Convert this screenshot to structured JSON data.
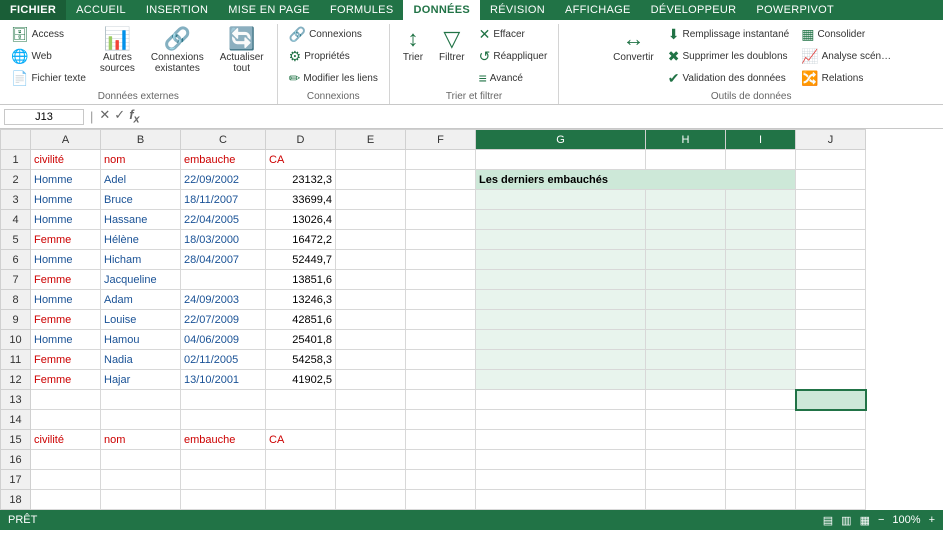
{
  "ribbon": {
    "tabs": [
      {
        "label": "FICHIER",
        "active": false
      },
      {
        "label": "ACCUEIL",
        "active": false
      },
      {
        "label": "INSERTION",
        "active": false
      },
      {
        "label": "MISE EN PAGE",
        "active": false
      },
      {
        "label": "FORMULES",
        "active": false
      },
      {
        "label": "DONNÉES",
        "active": true
      },
      {
        "label": "RÉVISION",
        "active": false
      },
      {
        "label": "AFFICHAGE",
        "active": false
      },
      {
        "label": "DÉVELOPPEUR",
        "active": false
      },
      {
        "label": "POWERPIVOT",
        "active": false
      }
    ],
    "groups": {
      "donnees_externes": {
        "label": "Données externes",
        "items": [
          {
            "label": "Access",
            "icon": "🗄"
          },
          {
            "label": "Web",
            "icon": "🌐"
          },
          {
            "label": "Fichier texte",
            "icon": "📄"
          },
          {
            "label": "Autres sources",
            "icon": "📊"
          },
          {
            "label": "Connexions existantes",
            "icon": "🔗"
          },
          {
            "label": "Actualiser tout",
            "icon": "🔄"
          }
        ]
      },
      "connexions": {
        "label": "Connexions",
        "items": [
          {
            "label": "Connexions",
            "icon": "🔗"
          },
          {
            "label": "Propriétés",
            "icon": "⚙"
          },
          {
            "label": "Modifier les liens",
            "icon": "✏"
          }
        ]
      },
      "trier_filtrer": {
        "label": "Trier et filtrer",
        "items": [
          {
            "label": "Trier",
            "icon": "↕"
          },
          {
            "label": "Filtrer",
            "icon": "▼"
          },
          {
            "label": "Effacer",
            "icon": "✕"
          },
          {
            "label": "Réappliquer",
            "icon": "↺"
          },
          {
            "label": "Avancé",
            "icon": "≡"
          }
        ]
      },
      "outils_donnees": {
        "label": "Outils de données",
        "items": [
          {
            "label": "Remplissage instantané",
            "icon": "⬇"
          },
          {
            "label": "Supprimer les doublons",
            "icon": "✖"
          },
          {
            "label": "Validation des données",
            "icon": "✔"
          },
          {
            "label": "Consolider",
            "icon": "▦"
          },
          {
            "label": "Analyse scén…",
            "icon": "📈"
          },
          {
            "label": "Convertir",
            "icon": "↔"
          },
          {
            "label": "Relations",
            "icon": "🔀"
          }
        ]
      }
    }
  },
  "formula_bar": {
    "cell_ref": "J13",
    "formula": ""
  },
  "columns": [
    "",
    "A",
    "B",
    "C",
    "D",
    "E",
    "F",
    "G",
    "H",
    "I",
    "J"
  ],
  "rows": [
    {
      "num": "1",
      "cells": [
        "civilité",
        "nom",
        "embauche",
        "CA",
        "",
        "",
        "",
        "",
        "",
        ""
      ]
    },
    {
      "num": "2",
      "cells": [
        "Homme",
        "Adel",
        "22/09/2002",
        "23132,3",
        "",
        "",
        "Les derniers embauchés",
        "",
        "",
        ""
      ]
    },
    {
      "num": "3",
      "cells": [
        "Homme",
        "Bruce",
        "18/11/2007",
        "33699,4",
        "",
        "",
        "",
        "",
        "",
        ""
      ]
    },
    {
      "num": "4",
      "cells": [
        "Homme",
        "Hassane",
        "22/04/2005",
        "13026,4",
        "",
        "",
        "",
        "",
        "",
        ""
      ]
    },
    {
      "num": "5",
      "cells": [
        "Femme",
        "Hélène",
        "18/03/2000",
        "16472,2",
        "",
        "",
        "",
        "",
        "",
        ""
      ]
    },
    {
      "num": "6",
      "cells": [
        "Homme",
        "Hicham",
        "28/04/2007",
        "52449,7",
        "",
        "",
        "",
        "",
        "",
        ""
      ]
    },
    {
      "num": "7",
      "cells": [
        "Femme",
        "Jacqueline",
        "",
        "13851,6",
        "",
        "",
        "",
        "",
        "",
        ""
      ]
    },
    {
      "num": "8",
      "cells": [
        "Homme",
        "Adam",
        "24/09/2003",
        "13246,3",
        "",
        "",
        "",
        "",
        "",
        ""
      ]
    },
    {
      "num": "9",
      "cells": [
        "Femme",
        "Louise",
        "22/07/2009",
        "42851,6",
        "",
        "",
        "",
        "",
        "",
        ""
      ]
    },
    {
      "num": "10",
      "cells": [
        "Homme",
        "Hamou",
        "04/06/2009",
        "25401,8",
        "",
        "",
        "",
        "",
        "",
        ""
      ]
    },
    {
      "num": "11",
      "cells": [
        "Femme",
        "Nadia",
        "02/11/2005",
        "54258,3",
        "",
        "",
        "",
        "",
        "",
        ""
      ]
    },
    {
      "num": "12",
      "cells": [
        "Femme",
        "Hajar",
        "13/10/2001",
        "41902,5",
        "",
        "",
        "",
        "",
        "",
        ""
      ]
    },
    {
      "num": "13",
      "cells": [
        "",
        "",
        "",
        "",
        "",
        "",
        "",
        "",
        "",
        ""
      ]
    },
    {
      "num": "14",
      "cells": [
        "",
        "",
        "",
        "",
        "",
        "",
        "",
        "",
        "",
        ""
      ]
    },
    {
      "num": "15",
      "cells": [
        "civilité",
        "nom",
        "embauche",
        "CA",
        "",
        "",
        "",
        "",
        "",
        ""
      ]
    },
    {
      "num": "16",
      "cells": [
        "",
        "",
        "",
        "",
        "",
        "",
        "",
        "",
        "",
        ""
      ]
    },
    {
      "num": "17",
      "cells": [
        "",
        "",
        "",
        "",
        "",
        "",
        "",
        "",
        "",
        ""
      ]
    },
    {
      "num": "18",
      "cells": [
        "",
        "",
        "",
        "",
        "",
        "",
        "",
        "",
        "",
        ""
      ]
    }
  ],
  "status": {
    "ready": "PRÊT",
    "right": "𝄜 𝄜 𝄜 100% ⊖ ⊕"
  }
}
